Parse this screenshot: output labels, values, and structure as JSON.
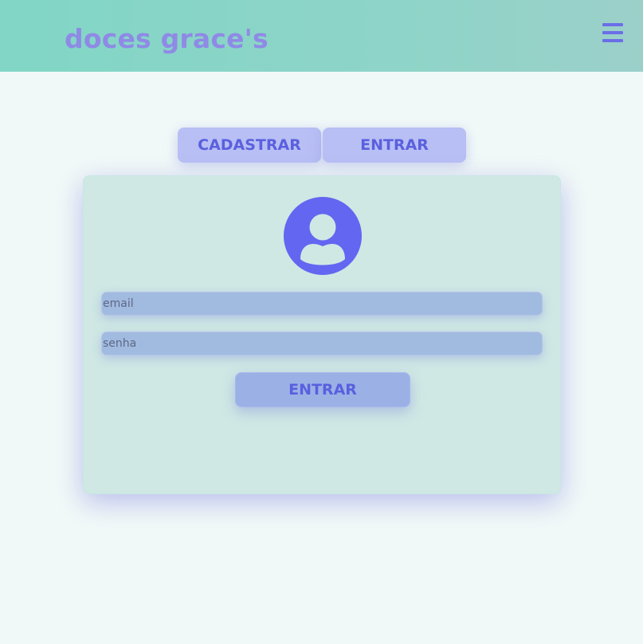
{
  "header": {
    "brand": "doces grace's",
    "menu_icon": "hamburger-menu-icon"
  },
  "tabs": [
    {
      "label": "CADASTRAR"
    },
    {
      "label": "ENTRAR"
    }
  ],
  "login_form": {
    "avatar_icon": "user-avatar-icon",
    "email_placeholder": "email",
    "password_placeholder": "senha",
    "submit_label": "ENTRAR"
  },
  "colors": {
    "header_bg": "#81d6c6",
    "page_bg": "#f1f9f8",
    "accent": "#6366f1",
    "brand_text": "#8f8ae6",
    "card_bg": "#cfe8e4",
    "tab_bg": "#b8bff4"
  }
}
